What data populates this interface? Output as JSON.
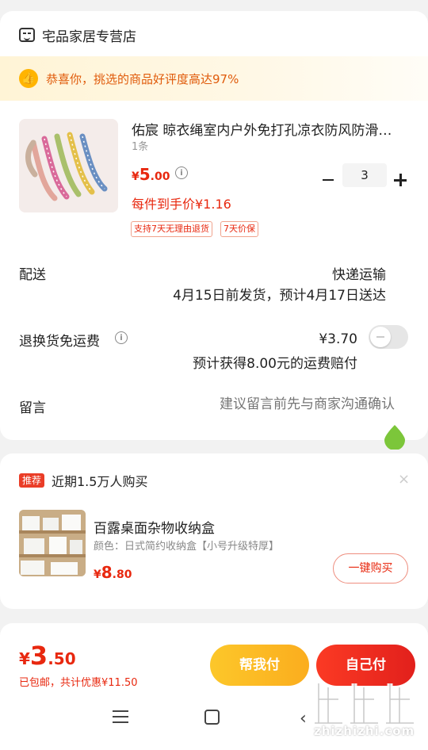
{
  "store": {
    "name": "宅品家居专营店",
    "icon": "store-icon"
  },
  "promo": {
    "text": "恭喜你，挑选的商品好评度高达97%",
    "icon": "thumbs-up-icon"
  },
  "product": {
    "title": "佑宸 晾衣绳室内户外免打孔凉衣防风防滑…",
    "spec": "1条",
    "price_symbol": "¥",
    "price_int": "5",
    "price_dec": ".00",
    "unit_price": "每件到手价¥1.16",
    "quantity": "3",
    "tags": [
      "支持7天无理由退货",
      "7天价保"
    ]
  },
  "delivery": {
    "label": "配送",
    "method": "快递运输",
    "eta": "4月15日前发货，预计4月17日送达"
  },
  "return_shipping": {
    "label": "退换货免运费",
    "price": "¥3.70",
    "note": "预计获得8.00元的运费赔付",
    "enabled": false
  },
  "message": {
    "label": "留言",
    "placeholder": "建议留言前先与商家沟通确认"
  },
  "recommend": {
    "badge": "推荐",
    "title": "近期1.5万人购买",
    "close": "×",
    "item": {
      "name": "百露桌面杂物收纳盒",
      "spec": "颜色：日式简约收纳盒【小号升级特厚】",
      "price_symbol": "¥",
      "price_int": "8",
      "price_dec": ".80",
      "button": "一键购买"
    }
  },
  "checkout": {
    "price_symbol": "¥",
    "price_int": "3",
    "price_dec": ".50",
    "note": "已包邮，共计优惠¥11.50",
    "help_pay": "帮我付",
    "self_pay": "自己付"
  },
  "watermark": {
    "text": "zhizhizhi.com"
  },
  "colors": {
    "accent": "#e8280f",
    "yellow": "#fbb921"
  }
}
